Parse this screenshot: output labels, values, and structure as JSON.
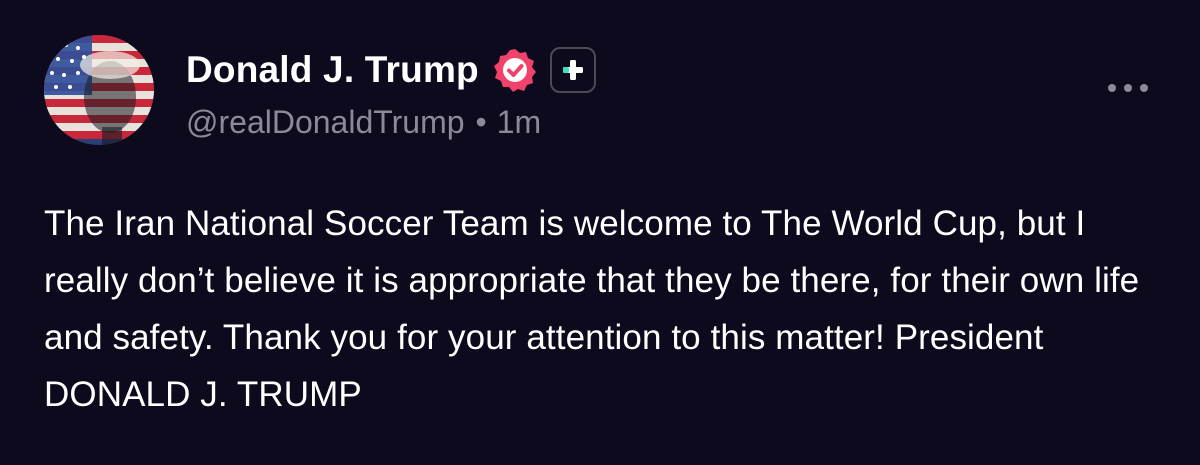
{
  "post": {
    "author_name": "Donald J. Trump",
    "handle": "@realDonaldTrump",
    "separator": "•",
    "timestamp": "1m",
    "body": "The Iran National Soccer Team is welcome to The World Cup, but I really don’t believe it is appropriate that they be there, for their own life and safety. Thank you for your attention to this matter! President DONALD J. TRUMP"
  },
  "icons": {
    "verified": "verified-badge-icon",
    "plus": "plus-badge-icon",
    "more": "more-options-icon"
  },
  "colors": {
    "background": "#0c0a1c",
    "text": "#ffffff",
    "muted": "#8a8a99",
    "verified": "#f0426b",
    "plus_accent": "#3fe0c0"
  }
}
